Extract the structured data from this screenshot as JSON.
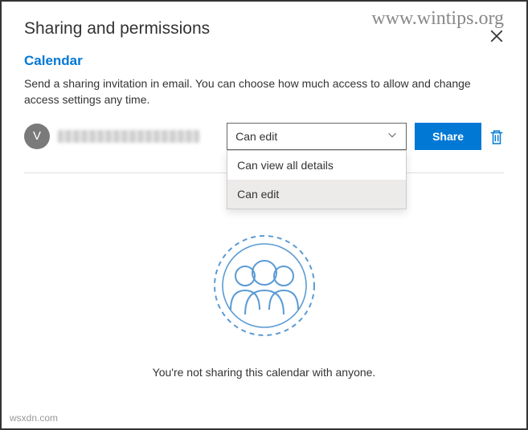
{
  "watermark": "www.wintips.org",
  "footer_watermark": "wsxdn.com",
  "panel": {
    "title": "Sharing and permissions"
  },
  "calendar": {
    "section_title": "Calendar",
    "description": "Send a sharing invitation in email. You can choose how much access to allow and change access settings any time."
  },
  "invitee": {
    "avatar_initial": "V"
  },
  "permission_select": {
    "value": "Can edit",
    "options": [
      "Can view all details",
      "Can edit"
    ],
    "selected_index": 1
  },
  "actions": {
    "share_label": "Share"
  },
  "empty_state": {
    "text": "You're not sharing this calendar with anyone."
  }
}
